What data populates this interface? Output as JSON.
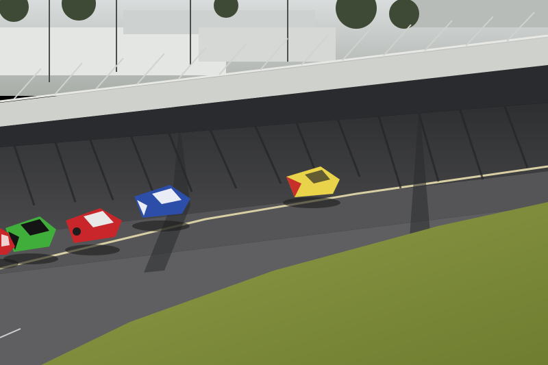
{
  "scene": {
    "subject": "stock-car-race-banked-oval",
    "colors": {
      "sky_haze": "#cfd6d8",
      "infield_grass": "#7d8a3a",
      "grass_light": "#8f9c48",
      "asphalt": "#5b5b5c",
      "banking": "#3f3f41",
      "apron": "#6e6e70",
      "wall": "#c9cbc6",
      "wall_shadow": "#1f2022",
      "stripe": "#d9cfa4"
    },
    "cars": [
      {
        "livery": "yellow-red",
        "colors": [
          "#e9d34a",
          "#c8312a"
        ]
      },
      {
        "livery": "blue-white",
        "colors": [
          "#2c4ea8",
          "#e9ecf4"
        ]
      },
      {
        "livery": "red-white",
        "colors": [
          "#c8262a",
          "#e8e8e8"
        ]
      },
      {
        "livery": "green-black",
        "colors": [
          "#3fae3a",
          "#141414"
        ]
      },
      {
        "livery": "red",
        "colors": [
          "#c8262a",
          "#f0d0d0"
        ]
      }
    ]
  }
}
